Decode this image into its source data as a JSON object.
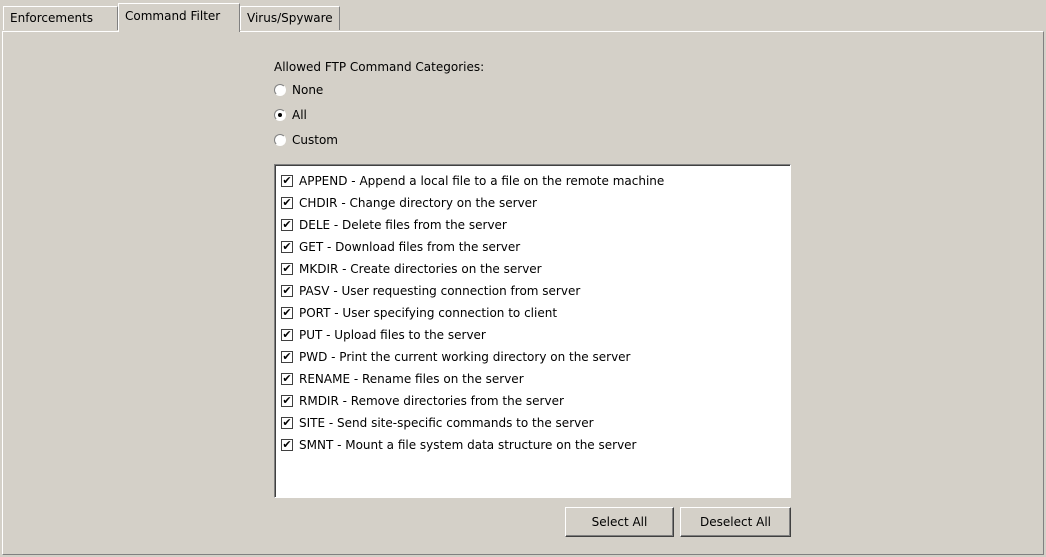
{
  "tabs": [
    {
      "label": "Enforcements",
      "active": false
    },
    {
      "label": "Command Filter",
      "active": true
    },
    {
      "label": "Virus/Spyware",
      "active": false
    }
  ],
  "category": {
    "label": "Allowed FTP Command Categories:",
    "options": [
      {
        "label": "None",
        "selected": false
      },
      {
        "label": "All",
        "selected": true
      },
      {
        "label": "Custom",
        "selected": false
      }
    ]
  },
  "commands": [
    {
      "label": "APPEND - Append a local file to a file on the remote machine",
      "checked": true
    },
    {
      "label": "CHDIR - Change directory on the server",
      "checked": true
    },
    {
      "label": "DELE - Delete files from the server",
      "checked": true
    },
    {
      "label": "GET - Download files from the server",
      "checked": true
    },
    {
      "label": "MKDIR - Create directories on the server",
      "checked": true
    },
    {
      "label": "PASV - User requesting connection from server",
      "checked": true
    },
    {
      "label": "PORT - User specifying connection to client",
      "checked": true
    },
    {
      "label": "PUT - Upload files to the server",
      "checked": true
    },
    {
      "label": "PWD - Print the current working directory on the server",
      "checked": true
    },
    {
      "label": "RENAME - Rename files on the server",
      "checked": true
    },
    {
      "label": "RMDIR - Remove directories from the server",
      "checked": true
    },
    {
      "label": "SITE - Send site-specific commands to the server",
      "checked": true
    },
    {
      "label": "SMNT - Mount a file system data structure on the server",
      "checked": true
    }
  ],
  "buttons": {
    "select_all": "Select All",
    "deselect_all": "Deselect All"
  }
}
